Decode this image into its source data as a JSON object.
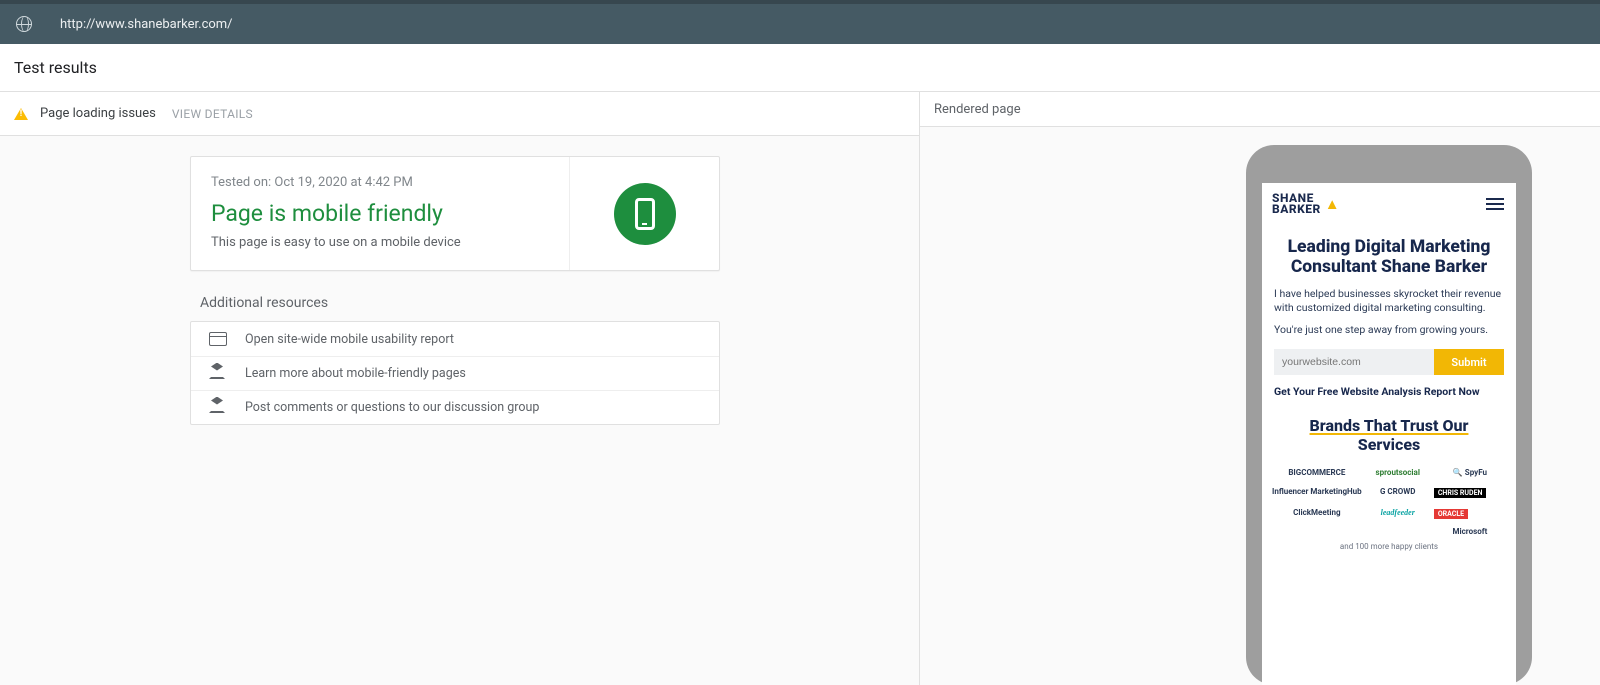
{
  "topbar": {
    "url": "http://www.shanebarker.com/"
  },
  "title": "Test results",
  "left": {
    "issues_label": "Page loading issues",
    "view_details": "VIEW DETAILS",
    "tested_on": "Tested on: Oct 19, 2020 at 4:42 PM",
    "result_title": "Page is mobile friendly",
    "result_sub": "This page is easy to use on a mobile device",
    "additional_title": "Additional resources",
    "resources": [
      "Open site-wide mobile usability report",
      "Learn more about mobile-friendly pages",
      "Post comments or questions to our discussion group"
    ]
  },
  "right": {
    "header": "Rendered page",
    "preview": {
      "brand1": "SHANE",
      "brand2": "BARKER",
      "hero": "Leading Digital Marketing Consultant Shane Barker",
      "p1": "I have helped businesses skyrocket their revenue with customized digital marketing consulting.",
      "p2": "You're just one step away from growing yours.",
      "placeholder": "yourwebsite.com",
      "submit": "Submit",
      "cta_bold": "Get Your Free Website Analysis Report Now",
      "h2a": "Brands That Trust Our",
      "h2b": "Services",
      "logos": [
        "BIGCOMMERCE",
        "sproutsocial",
        "🔍 SpyFu",
        "Influencer MarketingHub",
        "G CROWD",
        "CHRIS RUDEN",
        "ClickMeeting",
        "leadfeeder",
        "ORACLE",
        "Microsoft"
      ],
      "foot": "and 100 more happy clients"
    }
  }
}
